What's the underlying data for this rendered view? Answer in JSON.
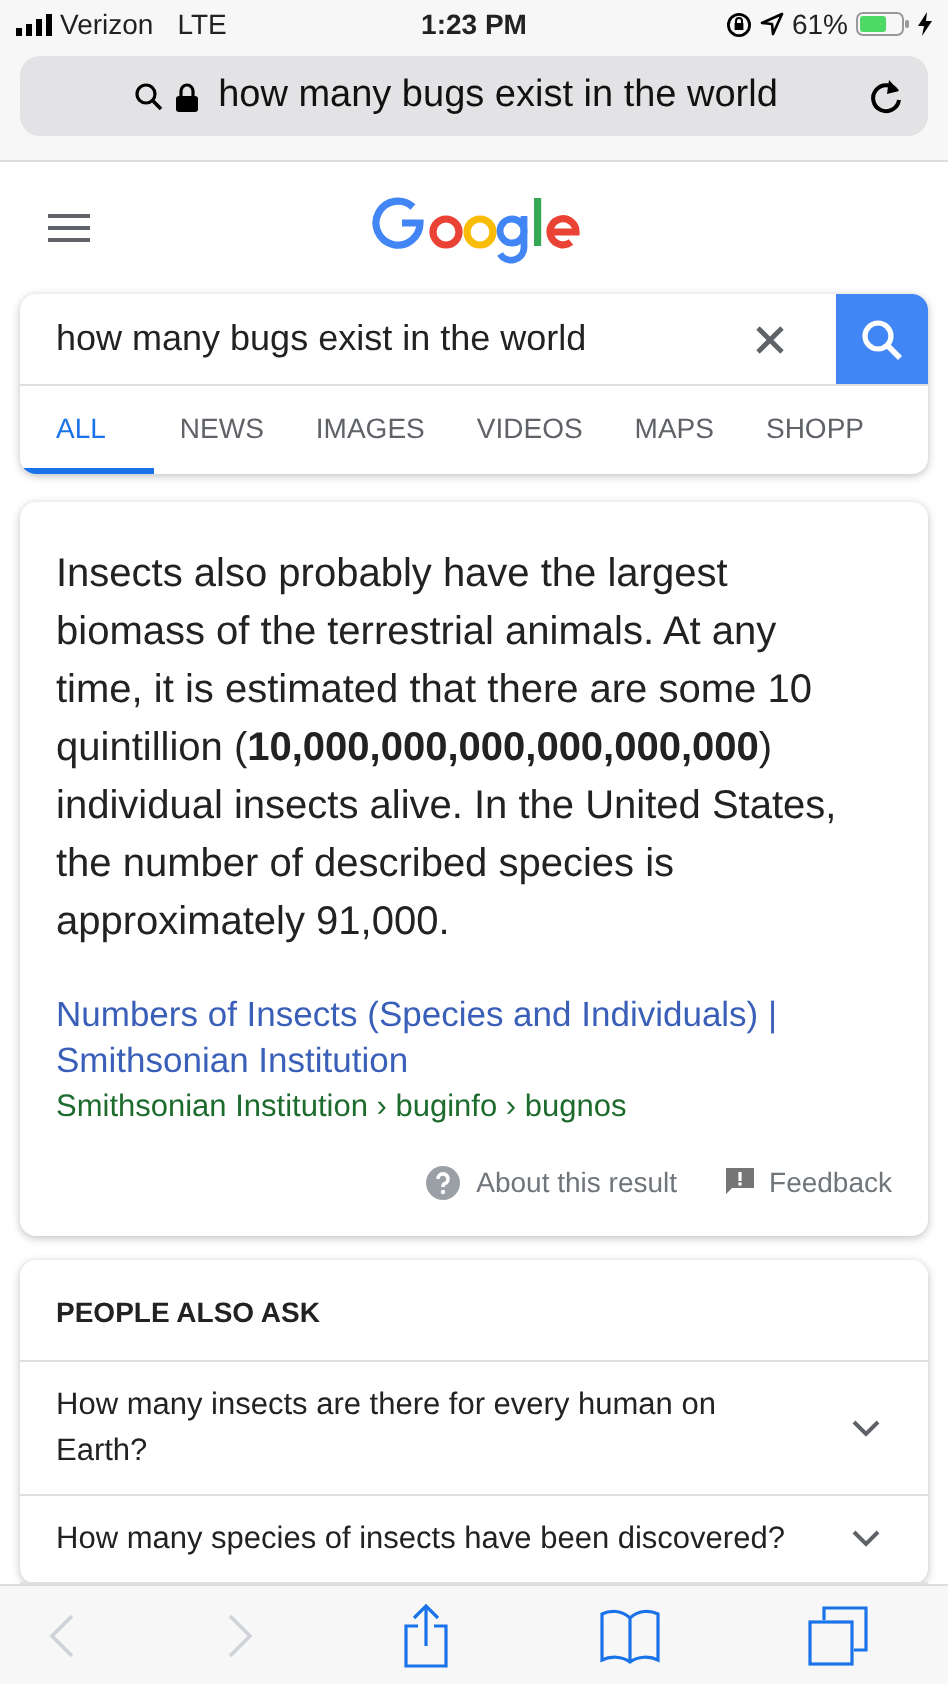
{
  "status_bar": {
    "carrier": "Verizon",
    "network": "LTE",
    "time": "1:23 PM",
    "battery": "61%"
  },
  "url_bar": {
    "text": "how many bugs exist in the world"
  },
  "search": {
    "value": "how many bugs exist in the world"
  },
  "tabs": [
    {
      "label": "ALL",
      "selected": true
    },
    {
      "label": "NEWS",
      "selected": false
    },
    {
      "label": "IMAGES",
      "selected": false
    },
    {
      "label": "VIDEOS",
      "selected": false
    },
    {
      "label": "MAPS",
      "selected": false
    },
    {
      "label": "SHOPP",
      "selected": false
    }
  ],
  "answer": {
    "text": "Insects also probably have the largest biomass of the terrestrial animals. At any time, it is estimated that there are some 10 quintillion (**10,000,000,000,000,000,000**) individual insects alive. In the United States, the number of described species is approximately 91,000.",
    "link": "Numbers of Insects (Species and Individuals) | Smithsonian Institution",
    "breadcrumb": "Smithsonian Institution › buginfo › bugnos",
    "about": "About this result",
    "feedback": "Feedback"
  },
  "people_also_ask": {
    "heading": "PEOPLE ALSO ASK",
    "questions": [
      "How many insects are there for every human on Earth?",
      "How many species of insects have been discovered?"
    ]
  },
  "toolbar": {
    "back_disabled": true,
    "forward_disabled": true
  }
}
